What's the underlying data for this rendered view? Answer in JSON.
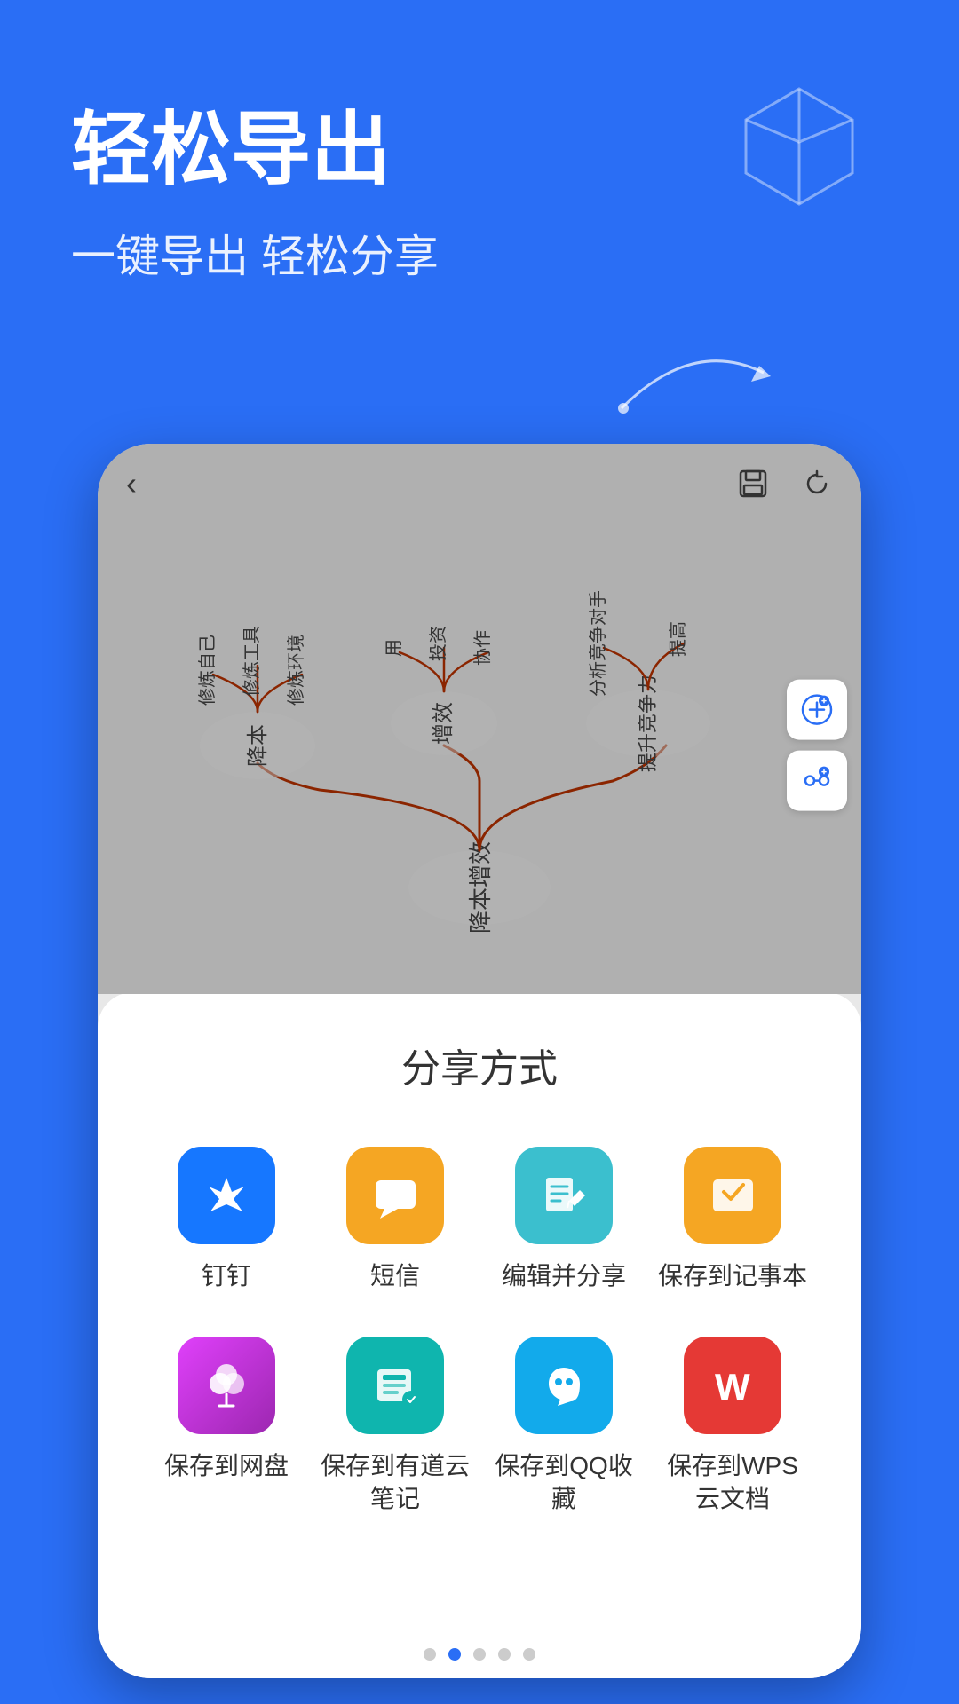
{
  "header": {
    "main_title": "轻松导出",
    "sub_title": "一键导出 轻松分享"
  },
  "toolbar": {
    "back_label": "‹",
    "save_icon": "save",
    "refresh_icon": "refresh"
  },
  "mindmap": {
    "root_node": "降本增效",
    "branch1": "降本",
    "branch2": "增效",
    "branch3": "提升竞争力",
    "leaf1_1": "修炼自己",
    "leaf1_2": "修炼工具",
    "leaf1_3": "修炼环境",
    "leaf2_1": "用",
    "leaf2_2": "投资",
    "leaf2_3": "协作",
    "leaf3_1": "分析竞争对手",
    "leaf3_2": "提高"
  },
  "share_sheet": {
    "title": "分享方式",
    "items": [
      {
        "id": "dingding",
        "label": "钉钉",
        "color_class": "icon-dingding"
      },
      {
        "id": "sms",
        "label": "短信",
        "color_class": "icon-sms"
      },
      {
        "id": "edit-share",
        "label": "编辑并分享",
        "color_class": "icon-edit"
      },
      {
        "id": "notes",
        "label": "保存到记事本",
        "color_class": "icon-notes"
      },
      {
        "id": "netdisk",
        "label": "保存到网盘",
        "color_class": "icon-netdisk"
      },
      {
        "id": "youdao",
        "label": "保存到有道云笔记",
        "color_class": "icon-youdao"
      },
      {
        "id": "qq",
        "label": "保存到QQ收藏",
        "color_class": "icon-qq"
      },
      {
        "id": "wps",
        "label": "保存到WPS云文档",
        "color_class": "icon-wps"
      }
    ]
  },
  "page_dots": {
    "total": 5,
    "active_index": 1
  },
  "icons": {
    "dingding_unicode": "✈",
    "sms_unicode": "💬",
    "edit_unicode": "✏",
    "notes_unicode": "✉",
    "netdisk_unicode": "☁",
    "youdao_unicode": "◆",
    "qq_unicode": "◎",
    "wps_unicode": "W"
  }
}
